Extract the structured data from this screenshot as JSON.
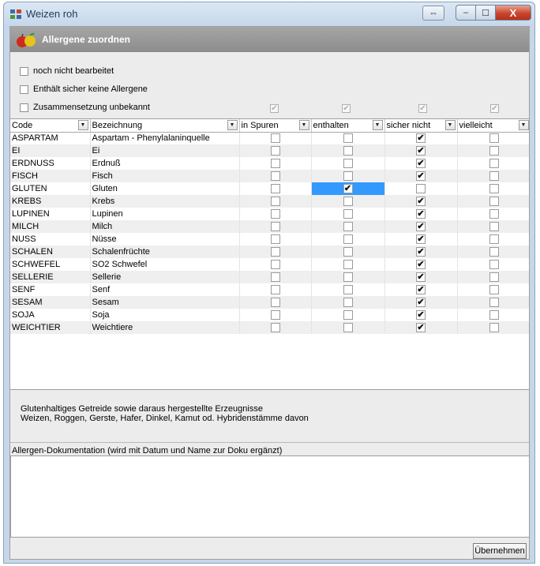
{
  "window": {
    "title": "Weizen roh",
    "snap_glyph": "⇔",
    "minimize_glyph": "–",
    "maximize_glyph": "☐",
    "close_glyph": "X"
  },
  "panel": {
    "title": "Allergene zuordnen"
  },
  "options": [
    {
      "label": "noch nicht bearbeitet",
      "checked": false
    },
    {
      "label": "Enthält sicher keine Allergene",
      "checked": false
    },
    {
      "label": "Zusammensetzung unbekannt",
      "checked": false
    }
  ],
  "grid": {
    "columns": [
      "Code",
      "Bezeichnung",
      "in Spuren",
      "enthalten",
      "sicher nicht",
      "vielleicht"
    ],
    "rows": [
      {
        "code": "ASPARTAM",
        "name": "Aspartam - Phenylalaninquelle",
        "checks": [
          false,
          false,
          true,
          false
        ]
      },
      {
        "code": "EI",
        "name": "Ei",
        "checks": [
          false,
          false,
          true,
          false
        ]
      },
      {
        "code": "ERDNUSS",
        "name": "Erdnuß",
        "checks": [
          false,
          false,
          true,
          false
        ]
      },
      {
        "code": "FISCH",
        "name": "Fisch",
        "checks": [
          false,
          false,
          true,
          false
        ]
      },
      {
        "code": "GLUTEN",
        "name": "Gluten",
        "checks": [
          false,
          true,
          false,
          false
        ],
        "selected_col": 1
      },
      {
        "code": "KREBS",
        "name": "Krebs",
        "checks": [
          false,
          false,
          true,
          false
        ]
      },
      {
        "code": "LUPINEN",
        "name": "Lupinen",
        "checks": [
          false,
          false,
          true,
          false
        ]
      },
      {
        "code": "MILCH",
        "name": "Milch",
        "checks": [
          false,
          false,
          true,
          false
        ]
      },
      {
        "code": "NUSS",
        "name": "Nüsse",
        "checks": [
          false,
          false,
          true,
          false
        ]
      },
      {
        "code": "SCHALEN",
        "name": "Schalenfrüchte",
        "checks": [
          false,
          false,
          true,
          false
        ]
      },
      {
        "code": "SCHWEFEL",
        "name": "SO2 Schwefel",
        "checks": [
          false,
          false,
          true,
          false
        ]
      },
      {
        "code": "SELLERIE",
        "name": "Sellerie",
        "checks": [
          false,
          false,
          true,
          false
        ]
      },
      {
        "code": "SENF",
        "name": "Senf",
        "checks": [
          false,
          false,
          true,
          false
        ]
      },
      {
        "code": "SESAM",
        "name": "Sesam",
        "checks": [
          false,
          false,
          true,
          false
        ]
      },
      {
        "code": "SOJA",
        "name": "Soja",
        "checks": [
          false,
          false,
          true,
          false
        ]
      },
      {
        "code": "WEICHTIER",
        "name": "Weichtiere",
        "checks": [
          false,
          false,
          true,
          false
        ]
      }
    ]
  },
  "description": {
    "line1": "Glutenhaltiges Getreide sowie daraus hergestellte Erzeugnisse",
    "line2": "Weizen, Roggen, Gerste, Hafer, Dinkel, Kamut od. Hybridenstämme davon"
  },
  "documentation": {
    "label": "Allergen-Dokumentation (wird mit Datum und Name zur Doku ergänzt)",
    "value": ""
  },
  "buttons": {
    "apply": "Übernehmen"
  },
  "check_glyph": "✔",
  "icons": {
    "app": "app-grid-icon",
    "panel": "apples-icon",
    "dropdown": "dropdown-arrow-icon"
  },
  "colors": {
    "selection": "#3399ff",
    "header_band": "#999999",
    "close_button": "#c9452b"
  }
}
